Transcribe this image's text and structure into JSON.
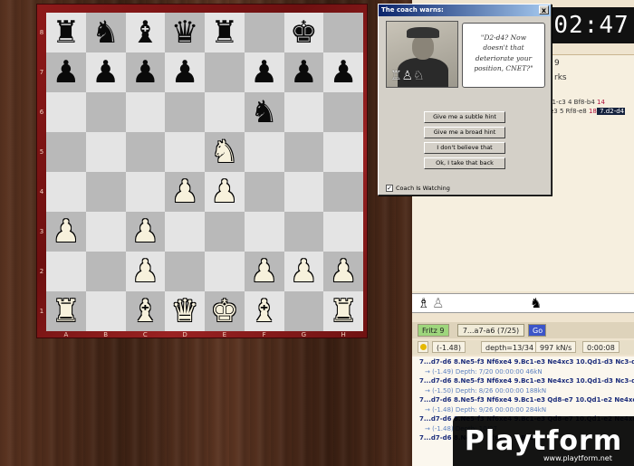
{
  "board": {
    "rank_labels": [
      "8",
      "7",
      "6",
      "5",
      "4",
      "3",
      "2",
      "1"
    ],
    "file_labels": [
      "A",
      "B",
      "C",
      "D",
      "E",
      "F",
      "G",
      "H"
    ],
    "rows": [
      [
        "br",
        "bn",
        "bb",
        "bq",
        "br",
        "",
        "bk",
        ""
      ],
      [
        "bp",
        "bp",
        "bp",
        "bp",
        "",
        "bp",
        "bp",
        "bp"
      ],
      [
        "",
        "",
        "",
        "",
        "",
        "bn",
        "",
        ""
      ],
      [
        "",
        "",
        "",
        "",
        "wn",
        "",
        "",
        ""
      ],
      [
        "",
        "",
        "",
        "wp",
        "wp",
        "",
        "",
        ""
      ],
      [
        "wp",
        "",
        "wp",
        "",
        "",
        "",
        "",
        ""
      ],
      [
        "",
        "",
        "wp",
        "",
        "",
        "wp",
        "wp",
        "wp"
      ],
      [
        "wr",
        "",
        "wb",
        "wq",
        "wk",
        "wb",
        "",
        "wr"
      ]
    ]
  },
  "clock": "02:47",
  "notation": {
    "header": "9",
    "sub": "rks",
    "lines": [
      {
        "parts": [
          {
            "t": "f1-c3  4 Bf8-b4 ",
            "c": ""
          },
          {
            "t": "14",
            "c": "red"
          }
        ]
      },
      {
        "parts": [
          {
            "t": "e3  5 Rf8-e8 ",
            "c": ""
          },
          {
            "t": "18",
            "c": "red"
          },
          {
            "t": " 7.d2-d4",
            "c": "hl"
          }
        ]
      }
    ]
  },
  "engine": {
    "name": "Fritz 9",
    "move": "7...a7-a6 (7/25)",
    "go": "Go",
    "stats": [
      "(-1.48)",
      "depth=13/34",
      "997 kN/s",
      "0:00:08"
    ]
  },
  "variations": [
    {
      "text": "7...d7-d6 8.Ne5-f3 Nf6xe4 9.Bc1-e3 Ne4xc3 10.Qd1-d3 Nc3-d5 11.Ra",
      "kind": "main"
    },
    {
      "text": "→ (-1.49)  Depth: 7/20  00:00:00  46kN",
      "kind": "sub"
    },
    {
      "text": "7...d7-d6 8.Ne5-f3 Nf6xe4 9.Bc1-e3 Ne4xc3 10.Qd1-d3 Nc3-d5 11.Ra",
      "kind": "main"
    },
    {
      "text": "→ (-1.50)  Depth: 8/26  00:00:00  188kN",
      "kind": "sub"
    },
    {
      "text": "7...d7-d6 8.Ne5-f3 Nf6xe4 9.Bc1-e3 Qd8-e7 10.Qd1-e2 Ne4xc3 11.Qe",
      "kind": "main"
    },
    {
      "text": "→ (-1.48)  Depth: 9/26  00:00:00  284kN",
      "kind": "sub"
    },
    {
      "text": "7...d7-d6 8.Ne5-f3 Nf6xe4 9.Bc1-e3 Qd8-e7 10.Qd1-e2 Ne4xc3 11.Qe",
      "kind": "main"
    },
    {
      "text": "→ (-1.48)  Depth: 10/27",
      "kind": "sub"
    },
    {
      "text": "7...d7-d6 8.Ne5-f3 Nf6xe4 9.Bc1-e3",
      "kind": "main"
    }
  ],
  "coach": {
    "title": "The coach warns:",
    "close": "x",
    "quote": "\"D2-d4? Now doesn't that deteriorate your position, CNET?\"",
    "buttons": [
      "Give me a subtle hint",
      "Give me a broad hint",
      "I don't believe that",
      "Ok, I take that back"
    ],
    "checkbox_label": "Coach Is Watching",
    "checked": "✓"
  },
  "watermark": {
    "logo": "Playtform",
    "url": "www.playtform.net"
  },
  "colors": {
    "board_light": "#e4e4e4",
    "board_dark": "#b9b9b9",
    "frame": "#8e1a1a",
    "engine_name_bg": "#9ed67c",
    "go_button": "#3c55c8"
  }
}
